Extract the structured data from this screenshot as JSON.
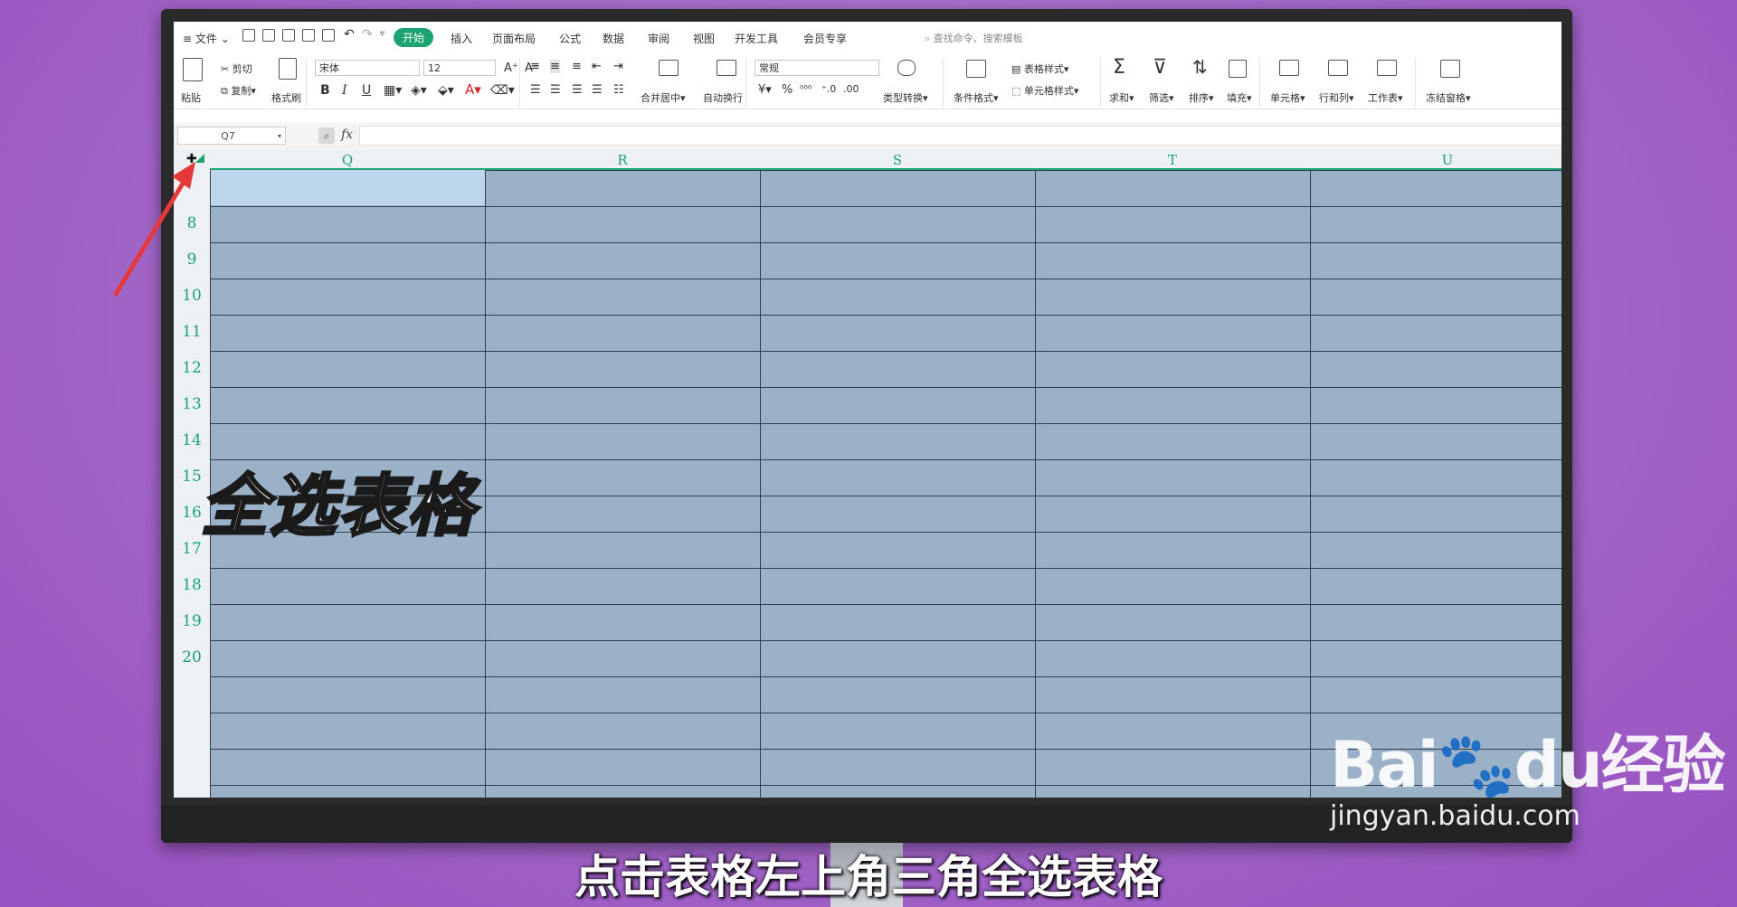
{
  "menu": {
    "file": "文件",
    "tabs": [
      "开始",
      "插入",
      "页面布局",
      "公式",
      "数据",
      "审阅",
      "视图",
      "开发工具",
      "会员专享"
    ],
    "search_placeholder": "查找命令、搜索模板"
  },
  "toolbar": {
    "paste": "粘贴",
    "cut": "剪切",
    "copy": "复制",
    "format_painter": "格式刷",
    "font_name": "宋体",
    "font_size": "12",
    "bold": "B",
    "italic": "I",
    "underline": "U",
    "merge_center": "合并居中",
    "wrap_text": "自动换行",
    "number_format": "常规",
    "type_convert": "类型转换",
    "cond_format": "条件格式",
    "table_style": "表格样式",
    "cell_style": "单元格样式",
    "sum": "求和",
    "filter": "筛选",
    "sort": "排序",
    "fill": "填充",
    "cell": "单元格",
    "row_col": "行和列",
    "worksheet": "工作表",
    "freeze": "冻结窗格"
  },
  "formula_bar": {
    "name_box": "Q7",
    "fx": "fx"
  },
  "sheet": {
    "columns": [
      "Q",
      "R",
      "S",
      "T",
      "U"
    ],
    "rows": [
      "8",
      "9",
      "10",
      "11",
      "12",
      "13",
      "14",
      "15",
      "16",
      "17",
      "18",
      "19",
      "20"
    ]
  },
  "overlay_text": "全选表格",
  "subtitle": "点击表格左上角三角全选表格",
  "watermark": {
    "brand": "Bai",
    "brand_suffix": "du经验",
    "url": "jingyan.baidu.com"
  },
  "colors": {
    "accent": "#1ba372",
    "selection": "#9bb1c8",
    "arrow": "#e5393c"
  }
}
